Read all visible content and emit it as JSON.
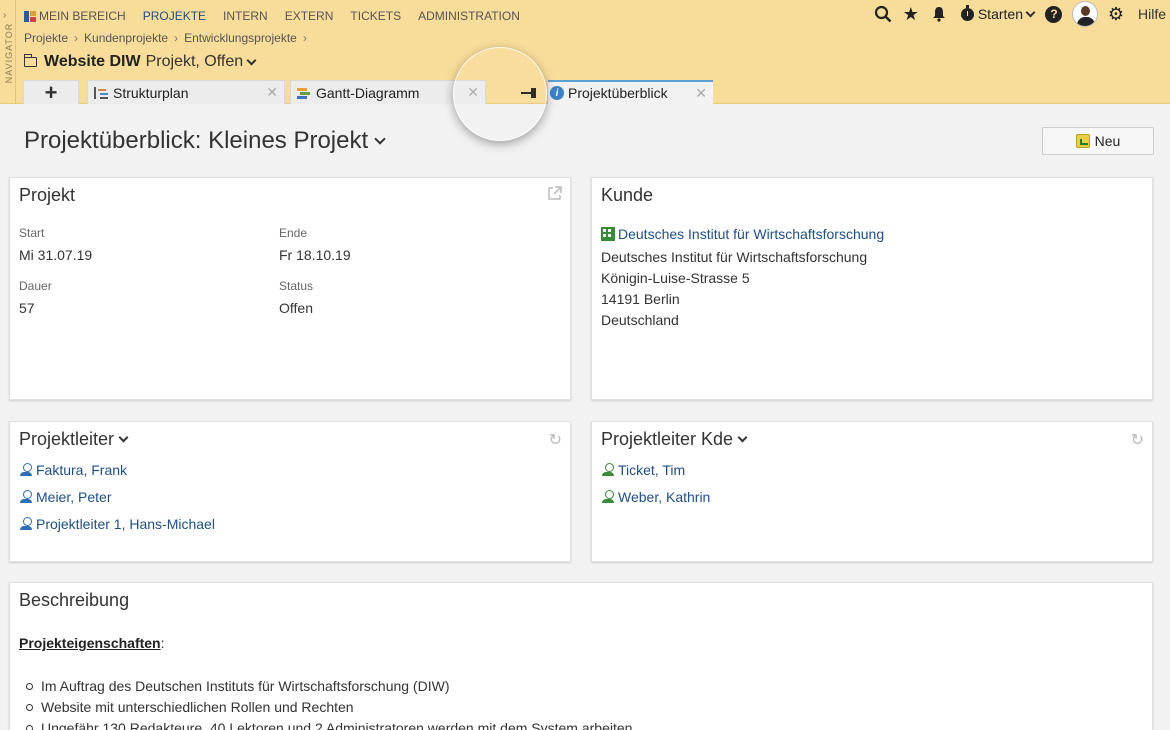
{
  "navigator": {
    "label": "NAVIGATOR"
  },
  "topnav": {
    "items": [
      {
        "label": "MEIN BEREICH"
      },
      {
        "label": "PROJEKTE"
      },
      {
        "label": "INTERN"
      },
      {
        "label": "EXTERN"
      },
      {
        "label": "TICKETS"
      },
      {
        "label": "ADMINISTRATION"
      }
    ],
    "active": "PROJEKTE"
  },
  "topright": {
    "starten_label": "Starten",
    "help_label": "Hilfe"
  },
  "breadcrumb": [
    "Projekte",
    "Kundenprojekte",
    "Entwicklungsprojekte"
  ],
  "project": {
    "name": "Website DIW",
    "meta": "Projekt, Offen"
  },
  "tabs": [
    {
      "label": "Strukturplan"
    },
    {
      "label": "Gantt-Diagramm"
    },
    {
      "label": "Projektüberblick"
    }
  ],
  "page": {
    "heading": "Projektüberblick: Kleines Projekt",
    "new_button": "Neu"
  },
  "projekt_card": {
    "title": "Projekt",
    "start_label": "Start",
    "start_value": "Mi 31.07.19",
    "ende_label": "Ende",
    "ende_value": "Fr 18.10.19",
    "dauer_label": "Dauer",
    "dauer_value": "57",
    "status_label": "Status",
    "status_value": "Offen"
  },
  "kunde_card": {
    "title": "Kunde",
    "link": "Deutsches Institut für Wirtschaftsforschung",
    "address": [
      "Deutsches Institut für Wirtschaftsforschung",
      "Königin-Luise-Strasse 5",
      "14191 Berlin",
      "Deutschland"
    ]
  },
  "projektleiter_card": {
    "title": "Projektleiter",
    "people": [
      "Faktura, Frank",
      "Meier, Peter",
      "Projektleiter 1, Hans-Michael"
    ]
  },
  "projektleiter_kde_card": {
    "title": "Projektleiter Kde",
    "people": [
      "Ticket, Tim",
      "Weber, Kathrin"
    ]
  },
  "beschreibung_card": {
    "title": "Beschreibung",
    "subheading": "Projekteigenschaften",
    "bullets": [
      "Im Auftrag des Deutschen Instituts für Wirtschaftsforschung (DIW)",
      "Website mit unterschiedlichen Rollen und Rechten",
      "Ungefähr 130 Redakteure, 40 Lektoren und 2 Administratoren werden mit dem System arbeiten"
    ]
  }
}
